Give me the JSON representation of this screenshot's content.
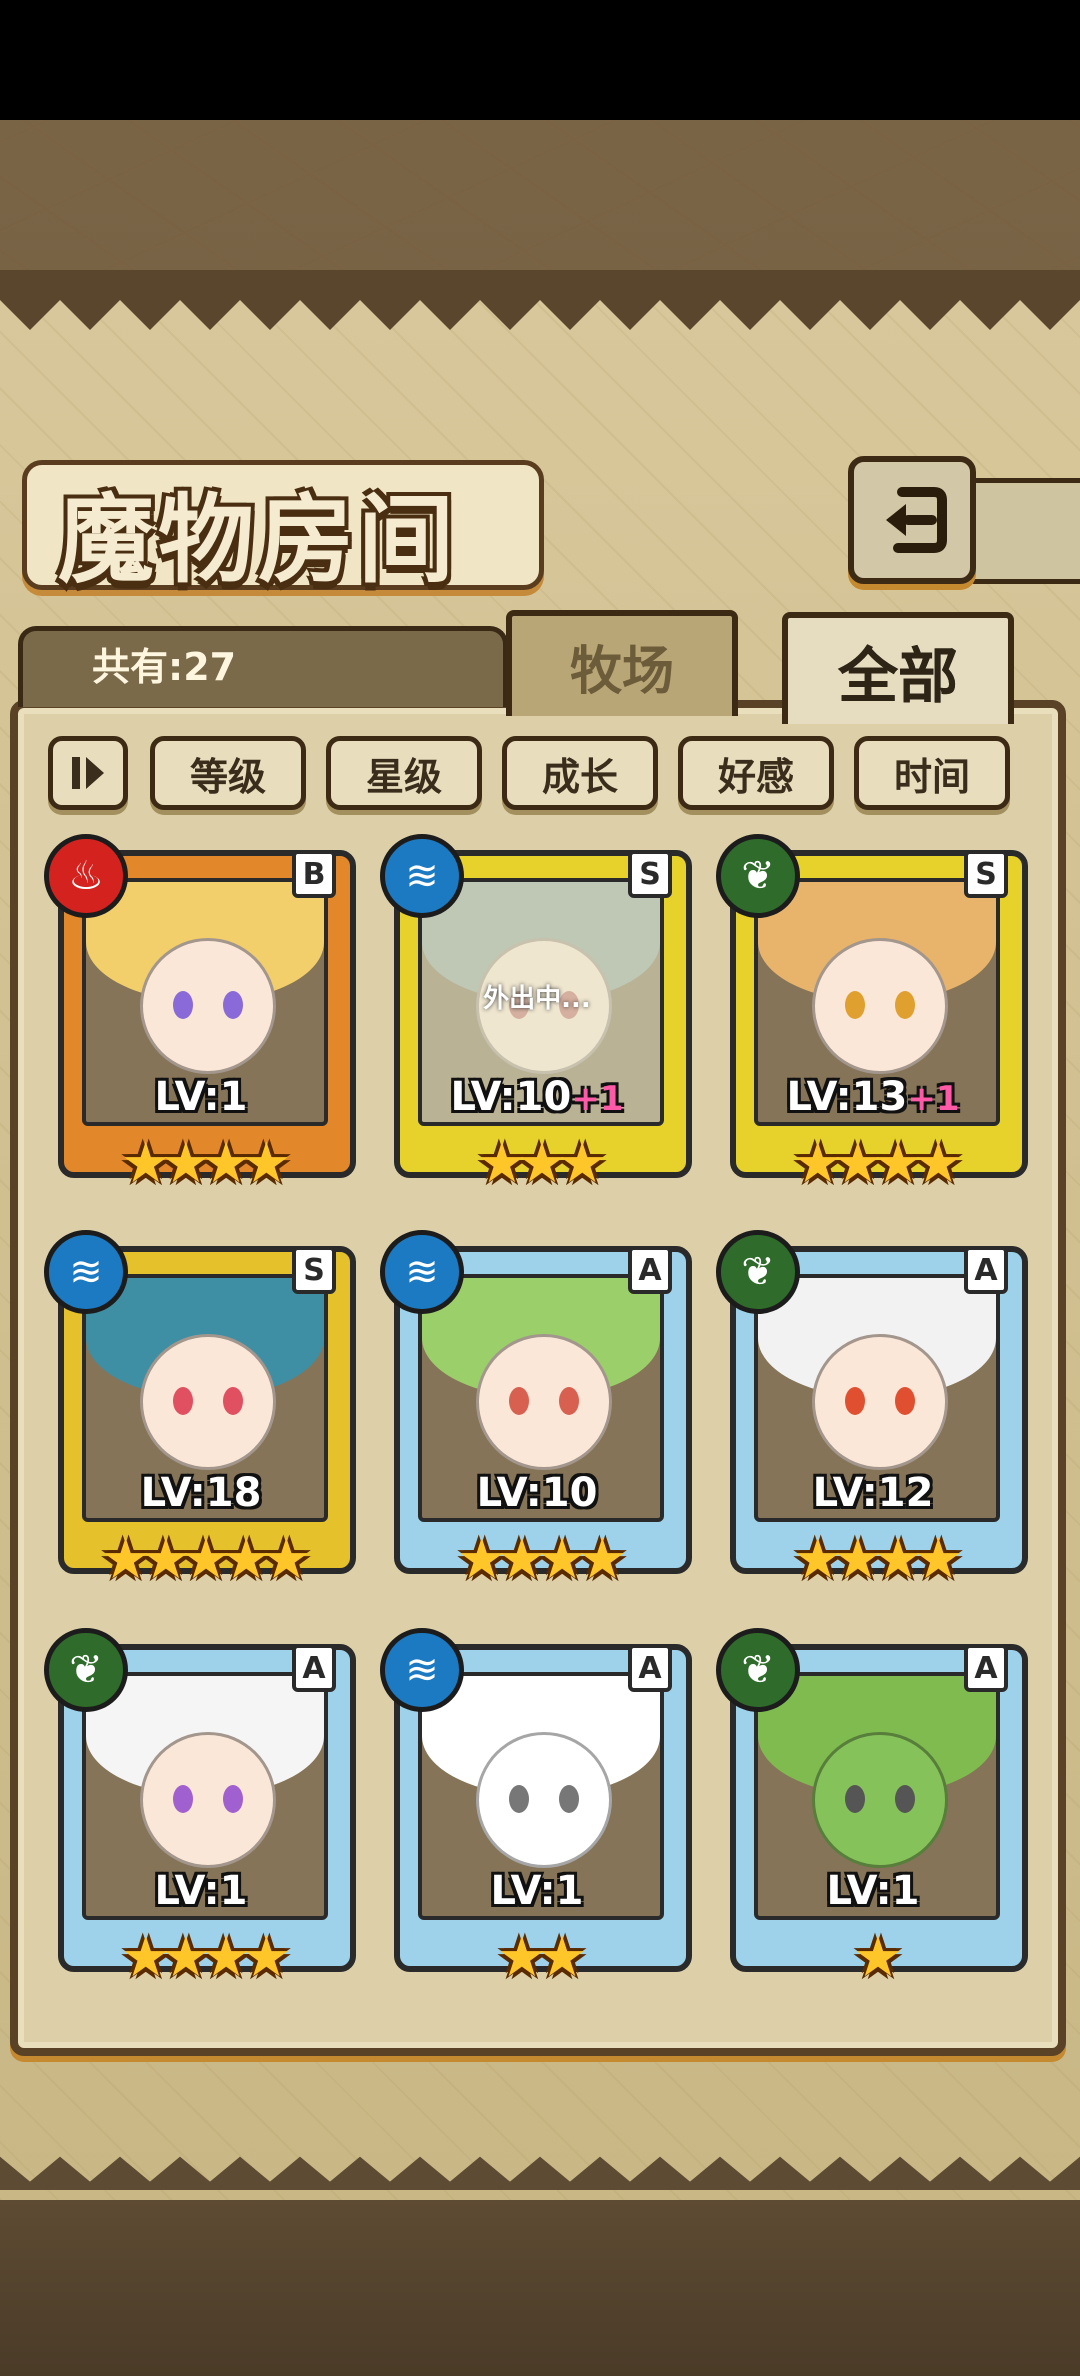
{
  "screen": {
    "title": "魔物房间",
    "total_count": "共有:27",
    "tabs": [
      {
        "label": "牧场",
        "selected": false
      },
      {
        "label": "全部",
        "selected": true
      }
    ],
    "filters": [
      {
        "label": "等级"
      },
      {
        "label": "星级"
      },
      {
        "label": "成长"
      },
      {
        "label": "好感"
      },
      {
        "label": "时间"
      }
    ]
  },
  "monsters": [
    {
      "element": "fire-icon",
      "rank": "B",
      "level_text": "LV:1",
      "bonus": "",
      "stars": "★★★★",
      "star_count": 4,
      "frame_color": "#e2882a",
      "status": ""
    },
    {
      "element": "water-icon",
      "rank": "S",
      "level_text": "LV:10",
      "bonus": "+1",
      "stars": "★★★",
      "star_count": 3,
      "frame_color": "#e6d22a",
      "status": "外出中..."
    },
    {
      "element": "leaf-icon",
      "rank": "S",
      "level_text": "LV:13",
      "bonus": "+1",
      "stars": "★★★★",
      "star_count": 4,
      "frame_color": "#e6d22a",
      "status": ""
    },
    {
      "element": "water-icon",
      "rank": "S",
      "level_text": "LV:18",
      "bonus": "",
      "stars": "★★★★★",
      "star_count": 5,
      "frame_color": "#e5c12c",
      "status": ""
    },
    {
      "element": "water-icon",
      "rank": "A",
      "level_text": "LV:10",
      "bonus": "",
      "stars": "★★★★",
      "star_count": 4,
      "frame_color": "#9ed2ea",
      "status": ""
    },
    {
      "element": "leaf-icon",
      "rank": "A",
      "level_text": "LV:12",
      "bonus": "",
      "stars": "★★★★",
      "star_count": 4,
      "frame_color": "#9ed2ea",
      "status": ""
    },
    {
      "element": "leaf-icon",
      "rank": "A",
      "level_text": "LV:1",
      "bonus": "",
      "stars": "★★★★",
      "star_count": 4,
      "frame_color": "#9ed2ea",
      "status": ""
    },
    {
      "element": "water-icon",
      "rank": "A",
      "level_text": "LV:1",
      "bonus": "",
      "stars": "★★",
      "star_count": 2,
      "frame_color": "#9ed2ea",
      "status": ""
    },
    {
      "element": "leaf-icon",
      "rank": "A",
      "level_text": "LV:1",
      "bonus": "",
      "stars": "★",
      "star_count": 1,
      "frame_color": "#9ed2ea",
      "status": ""
    }
  ],
  "colors": {
    "fire": "#d4231f",
    "water": "#1b7ac2",
    "leaf": "#2f6b2a"
  }
}
